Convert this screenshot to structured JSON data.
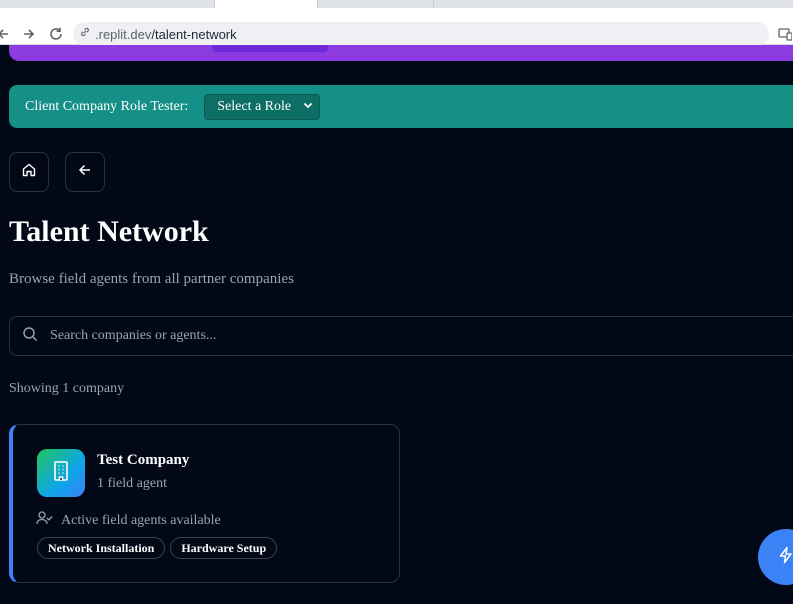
{
  "browser": {
    "url_host": ".replit.dev",
    "url_path": "/talent-network"
  },
  "role_tester": {
    "label": "Client Company Role Tester:",
    "selected": "Select a Role"
  },
  "page": {
    "title": "Talent Network",
    "subtitle": "Browse field agents from all partner companies"
  },
  "search": {
    "placeholder": "Search companies or agents..."
  },
  "results": {
    "summary": "Showing 1 company"
  },
  "companies": [
    {
      "name": "Test Company",
      "agent_count": "1 field agent",
      "availability": "Active field agents available",
      "skills": [
        "Network Installation",
        "Hardware Setup"
      ]
    }
  ],
  "colors": {
    "background": "#030816",
    "purple_banner": "#8b3be0",
    "teal_bar": "#149086",
    "accent_blue": "#3b82f6"
  },
  "icons": {
    "home": "home-icon",
    "back": "arrow-left-icon",
    "search": "search-icon",
    "company": "building-icon",
    "agents": "user-check-icon",
    "fab": "lightning-icon"
  }
}
